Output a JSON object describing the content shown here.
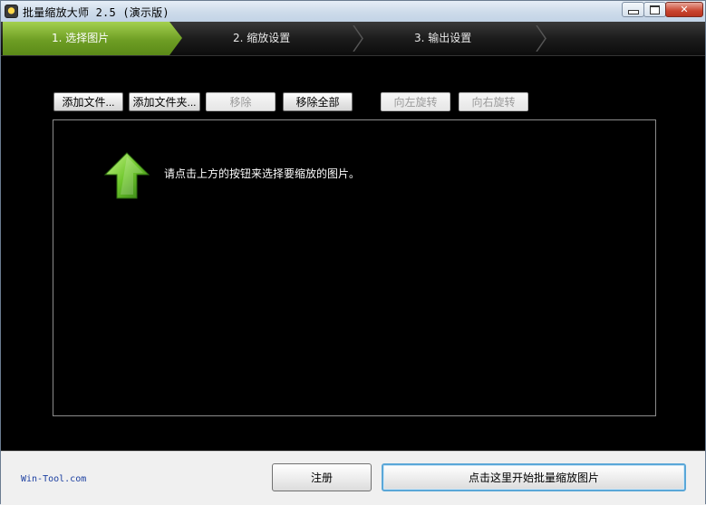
{
  "window": {
    "title": "批量缩放大师 2.5 (演示版)",
    "min_symbol": "",
    "close_symbol": "✕"
  },
  "steps": [
    {
      "label": "1. 选择图片"
    },
    {
      "label": "2. 缩放设置"
    },
    {
      "label": "3. 输出设置"
    }
  ],
  "toolbar": {
    "add_files": "添加文件...",
    "add_folder": "添加文件夹...",
    "remove": "移除",
    "remove_all": "移除全部",
    "rotate_left": "向左旋转",
    "rotate_right": "向右旋转"
  },
  "panel": {
    "hint": "请点击上方的按钮来选择要缩放的图片。"
  },
  "footer": {
    "brand": "Win-Tool.com",
    "register": "注册",
    "start": "点击这里开始批量缩放图片"
  },
  "colors": {
    "active_step": "#7fb02f",
    "background": "#000000",
    "arrow": "#7cd23a"
  }
}
